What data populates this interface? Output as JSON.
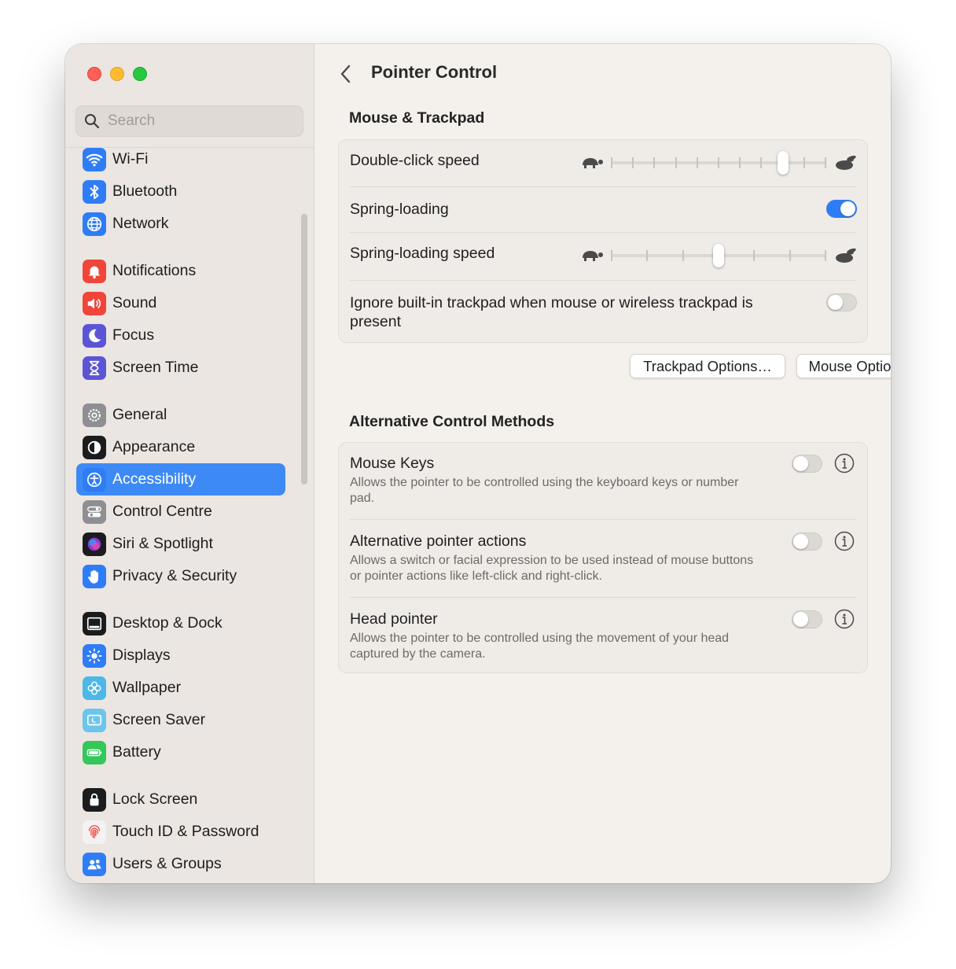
{
  "window": {
    "title": "Pointer Control"
  },
  "search": {
    "placeholder": "Search"
  },
  "sidebar": {
    "items": [
      {
        "label": "Wi-Fi",
        "icon": "wifi-icon",
        "color": "#2f7df6"
      },
      {
        "label": "Bluetooth",
        "icon": "bluetooth-icon",
        "color": "#2f7df6"
      },
      {
        "label": "Network",
        "icon": "globe-icon",
        "color": "#2f7df6"
      },
      {
        "label": "Notifications",
        "icon": "bell-icon",
        "color": "#f0453a"
      },
      {
        "label": "Sound",
        "icon": "speaker-icon",
        "color": "#f0453a"
      },
      {
        "label": "Focus",
        "icon": "moon-icon",
        "color": "#5b55d6"
      },
      {
        "label": "Screen Time",
        "icon": "hourglass-icon",
        "color": "#5b55d6"
      },
      {
        "label": "General",
        "icon": "gear-icon",
        "color": "#8e8e93"
      },
      {
        "label": "Appearance",
        "icon": "appearance-icon",
        "color": "#1c1c1e"
      },
      {
        "label": "Accessibility",
        "icon": "accessibility-icon",
        "color": "#2f7df6"
      },
      {
        "label": "Control Centre",
        "icon": "control-centre-icon",
        "color": "#8e8e93"
      },
      {
        "label": "Siri & Spotlight",
        "icon": "siri-icon",
        "color": "#8a3ad8"
      },
      {
        "label": "Privacy & Security",
        "icon": "hand-icon",
        "color": "#2f7df6"
      },
      {
        "label": "Desktop & Dock",
        "icon": "dock-icon",
        "color": "#1c1c1e"
      },
      {
        "label": "Displays",
        "icon": "sun-icon",
        "color": "#2f7df6"
      },
      {
        "label": "Wallpaper",
        "icon": "flower-icon",
        "color": "#4cb8e8"
      },
      {
        "label": "Screen Saver",
        "icon": "screen-saver-icon",
        "color": "#6cc6ec"
      },
      {
        "label": "Battery",
        "icon": "battery-icon",
        "color": "#34c759"
      },
      {
        "label": "Lock Screen",
        "icon": "lock-icon",
        "color": "#1c1c1e"
      },
      {
        "label": "Touch ID & Password",
        "icon": "fingerprint-icon",
        "color": "#f2f2f2"
      },
      {
        "label": "Users & Groups",
        "icon": "users-icon",
        "color": "#2f7df6"
      }
    ],
    "active": "Accessibility"
  },
  "mouse_trackpad": {
    "heading": "Mouse & Trackpad",
    "double_click": {
      "label": "Double-click speed",
      "ticks": 11,
      "value_index": 8
    },
    "spring_loading": {
      "label": "Spring-loading",
      "on": true
    },
    "spring_speed": {
      "label": "Spring-loading speed",
      "ticks": 7,
      "value_index": 3
    },
    "ignore_trackpad": {
      "label": "Ignore built-in trackpad when mouse or wireless trackpad is present",
      "on": false
    },
    "trackpad_button": "Trackpad Options…",
    "mouse_button": "Mouse Options…"
  },
  "alt_methods": {
    "heading": "Alternative Control Methods",
    "items": [
      {
        "label": "Mouse Keys",
        "desc": "Allows the pointer to be controlled using the keyboard keys or number pad.",
        "on": false
      },
      {
        "label": "Alternative pointer actions",
        "desc": "Allows a switch or facial expression to be used instead of mouse buttons or pointer actions like left-click and right-click.",
        "on": false
      },
      {
        "label": "Head pointer",
        "desc": "Allows the pointer to be controlled using the movement of your head captured by the camera.",
        "on": false
      }
    ]
  },
  "help_label": "?"
}
